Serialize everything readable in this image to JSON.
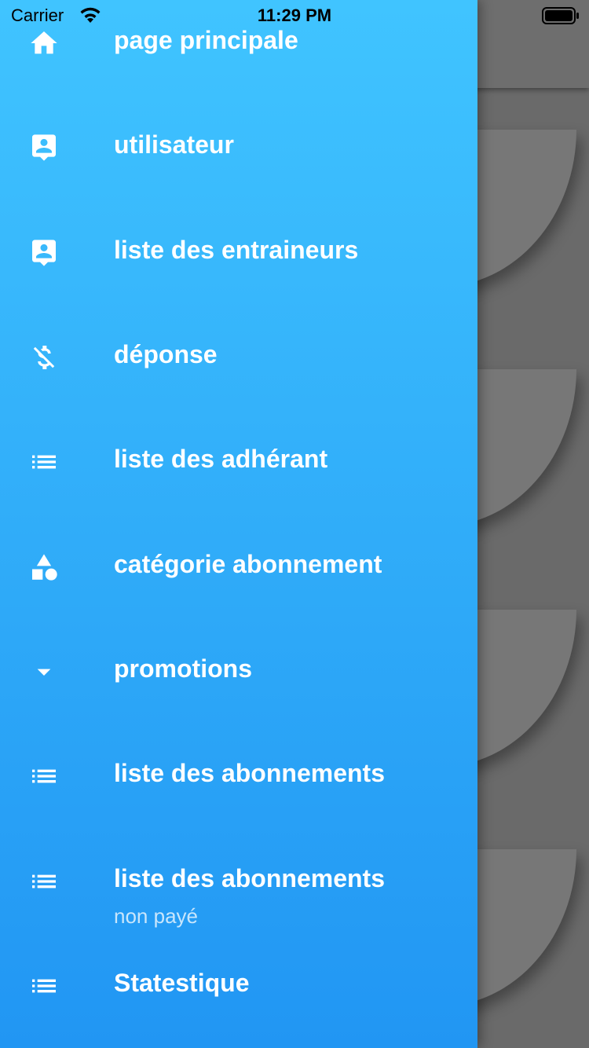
{
  "status_bar": {
    "carrier": "Carrier",
    "time": "11:29 PM"
  },
  "drawer": {
    "gradient_top": "#40c4ff",
    "gradient_bottom": "#2196f3",
    "items": [
      {
        "label": "page principale",
        "icon": "home-icon"
      },
      {
        "label": "utilisateur",
        "icon": "contact-icon"
      },
      {
        "label": "liste des entraineurs",
        "icon": "contact-icon"
      },
      {
        "label": "déponse",
        "icon": "money-off-icon"
      },
      {
        "label": "liste des adhérant",
        "icon": "list-icon"
      },
      {
        "label": "catégorie abonnement",
        "icon": "category-icon"
      },
      {
        "label": "promotions",
        "icon": "arrow-drop-down-icon"
      },
      {
        "label": "liste des abonnements",
        "icon": "list-icon"
      },
      {
        "label": "liste des abonnements",
        "sublabel": "non payé",
        "icon": "list-icon"
      },
      {
        "label": "Statestique",
        "icon": "list-icon"
      }
    ]
  }
}
